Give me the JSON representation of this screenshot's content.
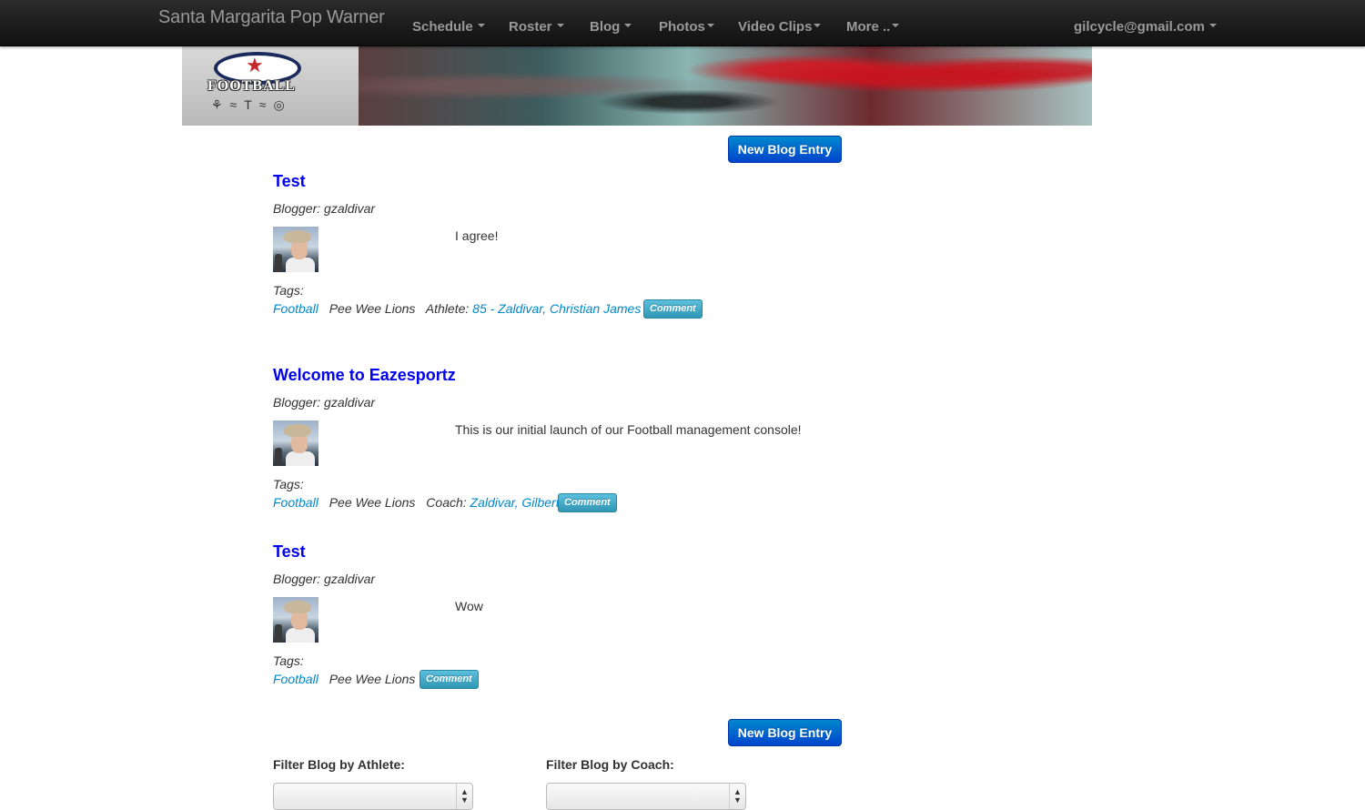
{
  "navbar": {
    "brand": "Santa Margarita Pop Warner",
    "items": [
      {
        "label": "Schedule"
      },
      {
        "label": "Roster"
      },
      {
        "label": "Blog"
      },
      {
        "label": "Photos"
      },
      {
        "label": "Video Clips"
      },
      {
        "label": "More .."
      }
    ],
    "user": "gilcycle@gmail.com"
  },
  "banner": {
    "logo_text": "FOOTBALL"
  },
  "actions": {
    "new_blog_entry_label": "New Blog Entry"
  },
  "posts": [
    {
      "title": "Test",
      "blogger": "Blogger: gzaldivar",
      "body": "I agree!",
      "tags_label": "Tags:",
      "sport": "Football",
      "team": "Pee Wee Lions",
      "role_label": "Athlete:",
      "person": "85 - Zaldivar, Christian James",
      "comment_label": "Comment"
    },
    {
      "title": "Welcome to Eazesportz",
      "blogger": "Blogger: gzaldivar",
      "body": "This is our initial launch of our Football management console!",
      "tags_label": "Tags:",
      "sport": "Football",
      "team": "Pee Wee Lions",
      "role_label": "Coach:",
      "person": "Zaldivar, Gilbert",
      "comment_label": "Comment"
    },
    {
      "title": "Test",
      "blogger": "Blogger: gzaldivar",
      "body": "Wow",
      "tags_label": "Tags:",
      "sport": "Football",
      "team": "Pee Wee Lions",
      "comment_label": "Comment"
    }
  ],
  "filters": {
    "athlete_label": "Filter Blog by Athlete:",
    "coach_label": "Filter Blog by Coach:"
  },
  "colors": {
    "navbar_bg": "#1b1b1b",
    "primary_button": "#0066cc",
    "comment_button": "#49afcd",
    "title_link": "#0000ee",
    "tag_link": "#0088cc"
  }
}
